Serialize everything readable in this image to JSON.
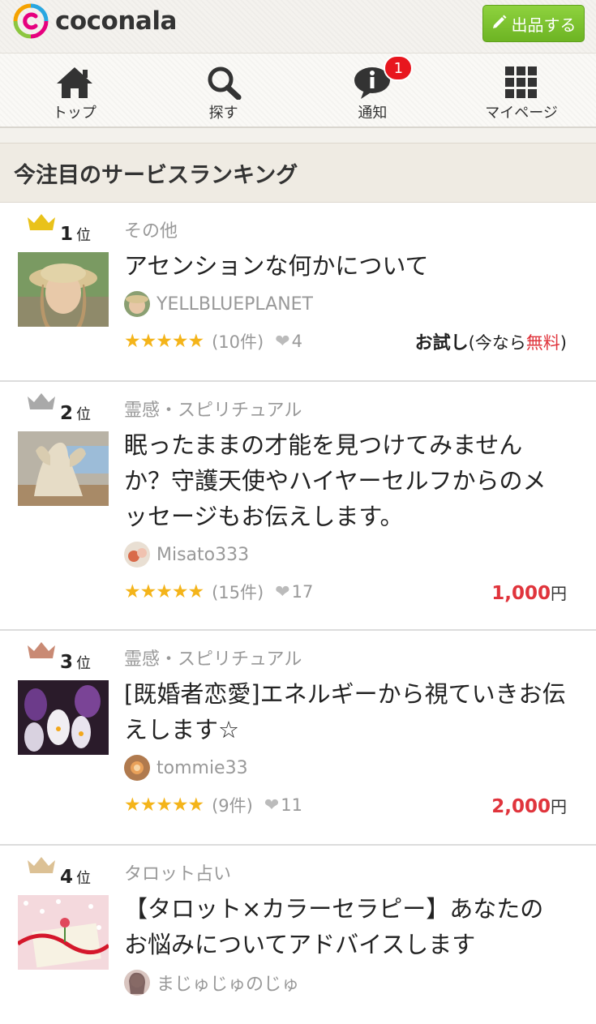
{
  "header": {
    "logo_text": "coconala",
    "list_button_label": "出品する"
  },
  "nav": [
    {
      "label": "トップ",
      "icon": "home-icon"
    },
    {
      "label": "探す",
      "icon": "search-icon"
    },
    {
      "label": "通知",
      "icon": "info-bubble-icon",
      "badge": "1"
    },
    {
      "label": "マイページ",
      "icon": "grid-icon"
    }
  ],
  "section": {
    "title": "今注目のサービスランキング"
  },
  "items": [
    {
      "rank": "1",
      "rank_suffix": "位",
      "crown_color": "#e9c21a",
      "category": "その他",
      "title": "アセンションな何かについて",
      "seller": "YELLBLUEPLANET",
      "stars": "★★★★★",
      "reviews": "(10件)",
      "favorites": "4",
      "trial_label": "お試し",
      "trial_open": "(今なら",
      "trial_free": "無料",
      "trial_close": ")"
    },
    {
      "rank": "2",
      "rank_suffix": "位",
      "crown_color": "#a9a9a9",
      "category": "霊感・スピリチュアル",
      "title": "眠ったままの才能を見つけてみませんか？守護天使やハイヤーセルフからのメッセージもお伝えします。",
      "seller": "Misato333",
      "stars": "★★★★★",
      "reviews": "(15件)",
      "favorites": "17",
      "price": "1,000",
      "currency": "円"
    },
    {
      "rank": "3",
      "rank_suffix": "位",
      "crown_color": "#c98a74",
      "category": "霊感・スピリチュアル",
      "title": "[既婚者恋愛]エネルギーから視ていきお伝えします☆",
      "seller": "tommie33",
      "stars": "★★★★★",
      "reviews": "(9件)",
      "favorites": "11",
      "price": "2,000",
      "currency": "円"
    },
    {
      "rank": "4",
      "rank_suffix": "位",
      "crown_color": "#dcc195",
      "category": "タロット占い",
      "title": "【タロット×カラーセラピー】あなたのお悩みについてアドバイスします",
      "seller": "まじゅじゅのじゅ"
    }
  ]
}
